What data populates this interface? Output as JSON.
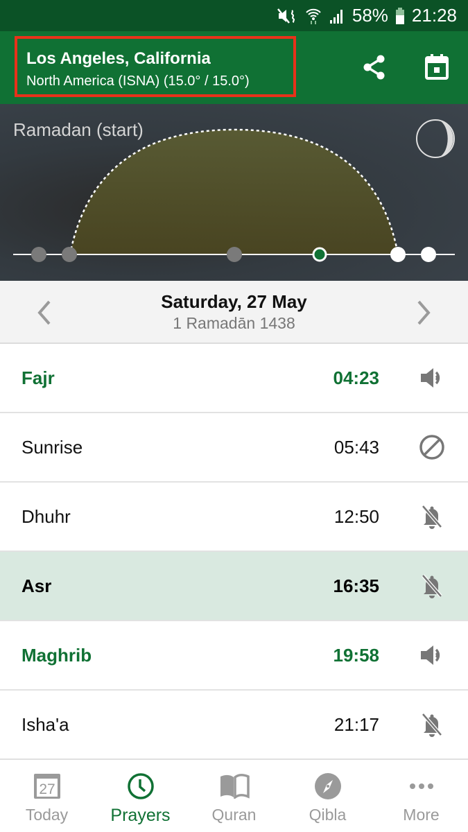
{
  "status_bar": {
    "icons": [
      "vibrate-mute-icon",
      "wifi-icon",
      "cell-signal-icon",
      "battery-icon"
    ],
    "battery": "58%",
    "time": "21:28"
  },
  "app_bar": {
    "location": "Los Angeles, California",
    "method": "North America (ISNA) (15.0° / 15.0°)",
    "actions": [
      "share-icon",
      "calendar-icon"
    ]
  },
  "hero": {
    "event_label": "Ramadan (start)",
    "moon_phase_icon": "moon-phase-icon",
    "timeline_markers": [
      {
        "prayer": "Fajr",
        "state": "past"
      },
      {
        "prayer": "Sunrise",
        "state": "past"
      },
      {
        "prayer": "Dhuhr",
        "state": "past"
      },
      {
        "prayer": "Asr",
        "state": "current"
      },
      {
        "prayer": "Maghrib",
        "state": "upcoming"
      },
      {
        "prayer": "Isha'a",
        "state": "upcoming"
      }
    ]
  },
  "date_nav": {
    "gregorian": "Saturday, 27 May",
    "hijri": "1 Ramadān 1438"
  },
  "prayers": [
    {
      "name": "Fajr",
      "time": "04:23",
      "alert": "sound",
      "style": "highlight"
    },
    {
      "name": "Sunrise",
      "time": "05:43",
      "alert": "off",
      "style": "normal"
    },
    {
      "name": "Dhuhr",
      "time": "12:50",
      "alert": "silent",
      "style": "normal"
    },
    {
      "name": "Asr",
      "time": "16:35",
      "alert": "silent",
      "style": "current"
    },
    {
      "name": "Maghrib",
      "time": "19:58",
      "alert": "sound",
      "style": "highlight"
    },
    {
      "name": "Isha'a",
      "time": "21:17",
      "alert": "silent",
      "style": "normal"
    }
  ],
  "bottom_nav": {
    "tabs": [
      {
        "label": "Today",
        "icon": "calendar-date-icon",
        "badge": "27",
        "active": false
      },
      {
        "label": "Prayers",
        "icon": "clock-icon",
        "active": true
      },
      {
        "label": "Quran",
        "icon": "book-icon",
        "active": false
      },
      {
        "label": "Qibla",
        "icon": "compass-icon",
        "active": false
      },
      {
        "label": "More",
        "icon": "more-dots-icon",
        "active": false
      }
    ]
  },
  "colors": {
    "primary": "#107134",
    "status_bar": "#0b5226",
    "highlight_box": "#e8321a",
    "current_row": "#d9e9e0",
    "icon_gray": "#777777"
  }
}
